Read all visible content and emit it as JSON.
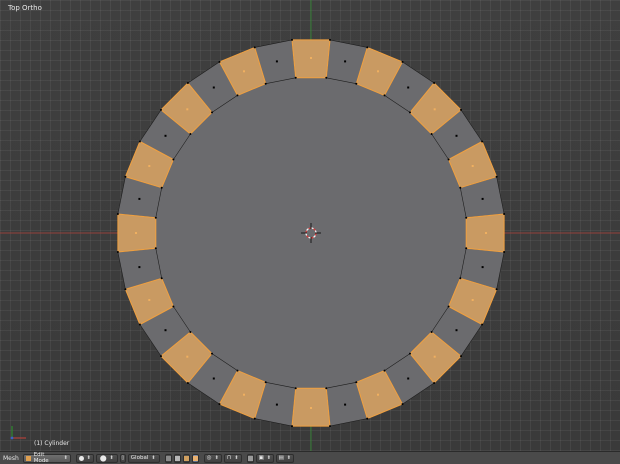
{
  "viewport": {
    "label": "Top Ortho",
    "object_info": "(1) Cylinder"
  },
  "mesh": {
    "segments": 32,
    "selected_faces": [
      0,
      2,
      4,
      6,
      8,
      10,
      12,
      14,
      16,
      18,
      20,
      22,
      24,
      26,
      28,
      30
    ],
    "colors": {
      "face": "#6b6b6e",
      "face_selected": "#c99a62",
      "edge": "#1e1e1e",
      "edge_selected": "#f0a040",
      "vertex": "#000000",
      "face_dot": "#000000",
      "face_dot_selected": "#f0b060"
    }
  },
  "header": {
    "editor_type": "Mesh",
    "mode": "Edit Mode",
    "orientation": "Global"
  },
  "colors": {
    "axis_x": "#b2413a",
    "axis_y": "#2f8a2f",
    "axis_z": "#3b62c4"
  }
}
